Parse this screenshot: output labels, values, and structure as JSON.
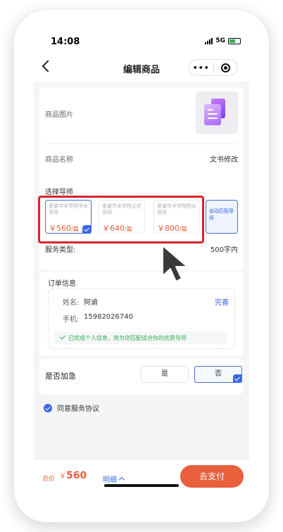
{
  "status_bar": {
    "time": "14:08",
    "network": "5G"
  },
  "nav": {
    "title": "编辑商品",
    "more": "•••"
  },
  "product": {
    "image_label": "商品图片",
    "name_label": "商品名称",
    "name_value": "文书修改"
  },
  "tutor_section": {
    "title": "选择导师",
    "tutors": [
      {
        "name": "思睿学术学院学术导师",
        "price": "￥560",
        "unit": "/篇",
        "selected": true
      },
      {
        "name": "思睿学术学院主任导师",
        "price": "￥640",
        "unit": "/篇",
        "selected": false
      },
      {
        "name": "思睿学术学院院长导师",
        "price": "￥800",
        "unit": "/篇",
        "selected": false
      }
    ],
    "auto_match": "自动匹配导师",
    "service_type_label": "服务类型:",
    "service_type_value": "500字内"
  },
  "order_info": {
    "title": "订单信息",
    "name_label": "姓名:",
    "name_value": "阿谕",
    "edit_link": "完善",
    "phone_label": "手机:",
    "phone_value": "15982026740",
    "complete_notice": "已完成个人信息，将为您匹配适合你的优质导师"
  },
  "urgent": {
    "label": "是否加急",
    "options": [
      "是",
      "否"
    ],
    "selected": "否"
  },
  "agreement": {
    "text": "同意服务协议",
    "checked": true
  },
  "footer": {
    "total_label": "总价",
    "currency": "￥",
    "total_value": "560",
    "detail_link": "明细",
    "pay_button": "去支付"
  },
  "colors": {
    "accent_blue": "#3b66e6",
    "price_orange": "#e8603c",
    "highlight_red": "#d8232a",
    "success_green": "#2fae4e"
  },
  "icons": [
    "back-icon",
    "more-icon",
    "target-icon",
    "document-icon",
    "check-icon",
    "chevron-up-icon",
    "cursor-icon"
  ]
}
